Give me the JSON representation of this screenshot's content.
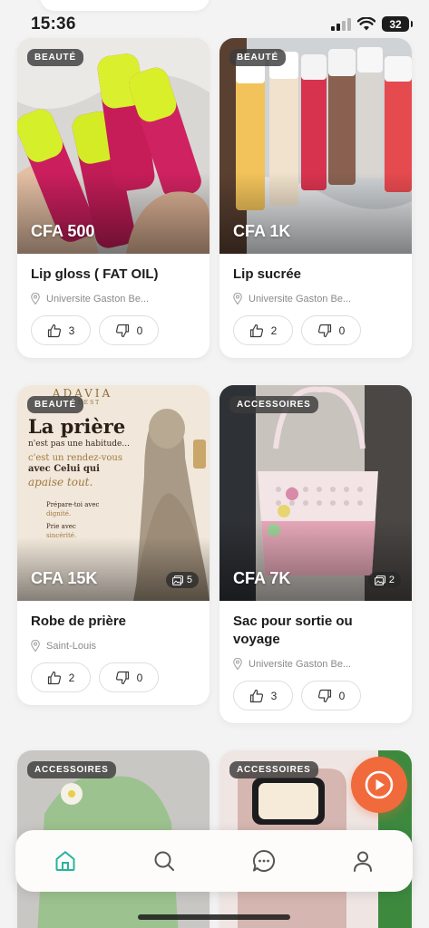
{
  "status_bar": {
    "time": "15:36",
    "battery": "32"
  },
  "products": [
    {
      "category": "BEAUTÉ",
      "price": "CFA 500",
      "title": "Lip gloss ( FAT OIL)",
      "location": "Universite Gaston Be...",
      "likes": "3",
      "dislikes": "0"
    },
    {
      "category": "BEAUTÉ",
      "price": "CFA 1K",
      "title": "Lip sucrée",
      "location": "Universite Gaston Be...",
      "likes": "2",
      "dislikes": "0"
    },
    {
      "category": "BEAUTÉ",
      "price": "CFA 15K",
      "image_count": "5",
      "title": "Robe de prière",
      "location": "Saint-Louis",
      "likes": "2",
      "dislikes": "0",
      "poster": {
        "brand": "ADAVIA",
        "brand_sub": "MODEST",
        "headline": "La prière",
        "line1": "n'est pas une habitude...",
        "line2": "c'est un rendez-vous",
        "line3": "avec Celui qui",
        "line4": "apaise tout.",
        "tip1a": "Prépare-toi avec",
        "tip1b": "dignité.",
        "tip2a": "Prie avec",
        "tip2b": "sincérité."
      }
    },
    {
      "category": "ACCESSOIRES",
      "price": "CFA 7K",
      "image_count": "2",
      "title": "Sac pour sortie ou voyage",
      "location": "Universite Gaston Be...",
      "likes": "3",
      "dislikes": "0"
    },
    {
      "category": "ACCESSOIRES"
    },
    {
      "category": "ACCESSOIRES"
    }
  ],
  "colors": {
    "accent": "#f16a3c",
    "nav_active": "#2bb39e",
    "badge_bg": "#3c3c3c"
  },
  "nav": [
    {
      "icon": "home-icon",
      "active": true
    },
    {
      "icon": "search-icon",
      "active": false
    },
    {
      "icon": "chat-icon",
      "active": false
    },
    {
      "icon": "profile-icon",
      "active": false
    }
  ]
}
